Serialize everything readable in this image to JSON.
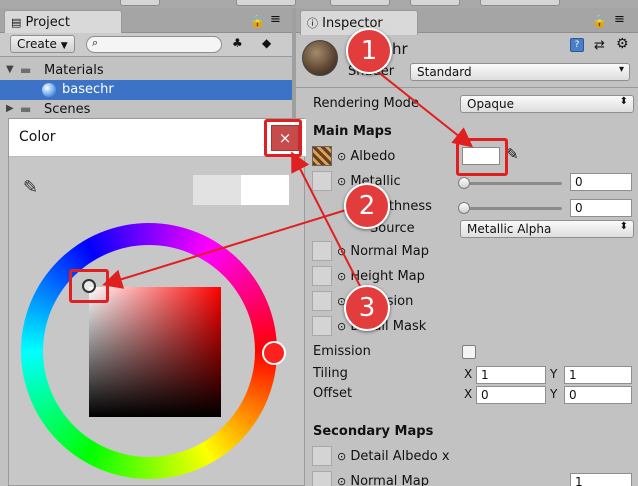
{
  "project": {
    "tab_label": "Project",
    "create_label": "Create",
    "tree": [
      {
        "label": "Materials"
      },
      {
        "label": "basechr"
      },
      {
        "label": "Scenes"
      }
    ]
  },
  "inspector": {
    "tab_label": "Inspector",
    "material_name": "basechr",
    "shader_label": "Shader",
    "shader_value": "Standard",
    "rendering_mode_label": "Rendering Mode",
    "rendering_mode_value": "Opaque",
    "main_maps_label": "Main Maps",
    "albedo_label": "Albedo",
    "metallic_label": "Metallic",
    "metallic_value": "0",
    "smoothness_label": "Smoothness",
    "smoothness_value": "0",
    "source_label": "Source",
    "source_value": "Metallic Alpha",
    "normal_map_label": "Normal Map",
    "height_map_label": "Height Map",
    "occlusion_label": "Occlusion",
    "detail_mask_label": "Detail Mask",
    "emission_label": "Emission",
    "tiling_label": "Tiling",
    "tiling_x": "1",
    "tiling_y": "1",
    "offset_label": "Offset",
    "offset_x": "0",
    "offset_y": "0",
    "x_label": "X",
    "y_label": "Y",
    "secondary_maps_label": "Secondary Maps",
    "detail_albedo_label": "Detail Albedo x",
    "secondary_normal_label": "Normal Map",
    "secondary_normal_value": "1"
  },
  "color_picker": {
    "title": "Color",
    "close_symbol": "×"
  },
  "annotations": {
    "badges": [
      "1",
      "2",
      "3"
    ],
    "color": "#e02020"
  }
}
